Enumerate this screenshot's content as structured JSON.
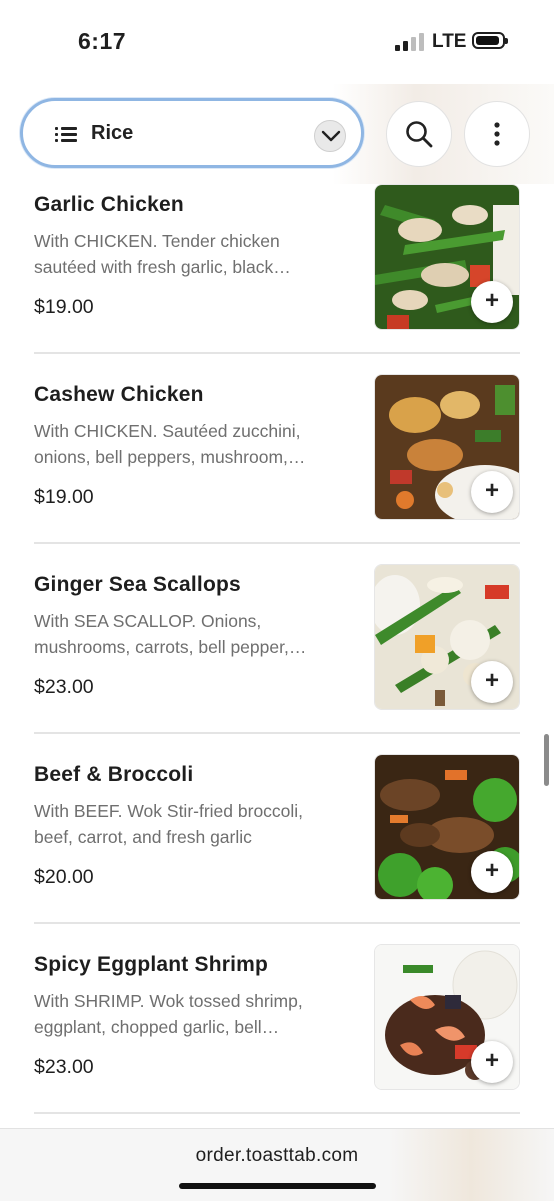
{
  "status_bar": {
    "time": "6:17",
    "network": "LTE"
  },
  "header": {
    "category": "Rice",
    "icons": {
      "menu": "list-icon",
      "dropdown": "chevron-down-icon",
      "search": "search-icon",
      "more": "more-vertical-icon"
    }
  },
  "menu_items": [
    {
      "name": "Garlic Chicken",
      "description": "With CHICKEN. Tender chicken sautéed with fresh garlic, black…",
      "price": "$19.00",
      "add_label": "+"
    },
    {
      "name": "Cashew Chicken",
      "description": "With CHICKEN. Sautéed zucchini, onions, bell peppers, mushroom,…",
      "price": "$19.00",
      "add_label": "+"
    },
    {
      "name": "Ginger Sea Scallops",
      "description": "With SEA SCALLOP. Onions, mushrooms, carrots, bell pepper,…",
      "price": "$23.00",
      "add_label": "+"
    },
    {
      "name": "Beef & Broccoli",
      "description": "With BEEF. Wok Stir-fried broccoli, beef, carrot, and fresh garlic",
      "price": "$20.00",
      "add_label": "+"
    },
    {
      "name": "Spicy Eggplant Shrimp",
      "description": "With SHRIMP. Wok tossed shrimp, eggplant, chopped garlic, bell…",
      "price": "$23.00",
      "add_label": "+"
    }
  ],
  "browser": {
    "url": "order.toasttab.com"
  },
  "colors": {
    "accent_border": "#8fb6e3",
    "text_primary": "#1e1e1e",
    "text_secondary": "#6f6f6f"
  }
}
